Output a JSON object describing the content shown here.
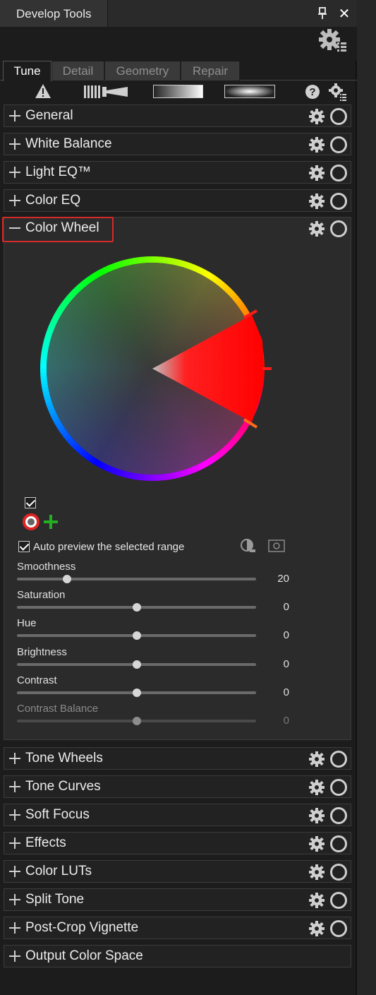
{
  "window": {
    "title": "Develop Tools",
    "pin_icon": "pin-icon",
    "close_icon": "close-icon"
  },
  "tabs": [
    {
      "label": "Tune",
      "active": true
    },
    {
      "label": "Detail",
      "active": false
    },
    {
      "label": "Geometry",
      "active": false
    },
    {
      "label": "Repair",
      "active": false
    }
  ],
  "toolbar": {
    "icons": [
      "warning-icon",
      "brush-icon",
      "gradient-icon",
      "radial-gradient-icon",
      "help-icon",
      "settings-list-icon"
    ]
  },
  "sections_top": [
    {
      "label": "General"
    },
    {
      "label": "White Balance"
    },
    {
      "label": "Light EQ™"
    },
    {
      "label": "Color EQ"
    }
  ],
  "color_wheel": {
    "label": "Color Wheel",
    "selected_hue_color": "#ff1a1a",
    "auto_preview_label": "Auto preview the selected range",
    "sliders": [
      {
        "label": "Smoothness",
        "value": "20",
        "position": 0.21,
        "enabled": true
      },
      {
        "label": "Saturation",
        "value": "0",
        "position": 0.5,
        "enabled": true
      },
      {
        "label": "Hue",
        "value": "0",
        "position": 0.5,
        "enabled": true
      },
      {
        "label": "Brightness",
        "value": "0",
        "position": 0.5,
        "enabled": true
      },
      {
        "label": "Contrast",
        "value": "0",
        "position": 0.5,
        "enabled": true
      },
      {
        "label": "Contrast Balance",
        "value": "0",
        "position": 0.5,
        "enabled": false
      }
    ]
  },
  "sections_bottom": [
    {
      "label": "Tone Wheels"
    },
    {
      "label": "Tone Curves"
    },
    {
      "label": "Soft Focus"
    },
    {
      "label": "Effects"
    },
    {
      "label": "Color LUTs"
    },
    {
      "label": "Split Tone"
    },
    {
      "label": "Post-Crop Vignette"
    },
    {
      "label": "Output Color Space"
    }
  ],
  "colors": {
    "highlight": "#d42a2a",
    "add_green": "#22b022"
  }
}
